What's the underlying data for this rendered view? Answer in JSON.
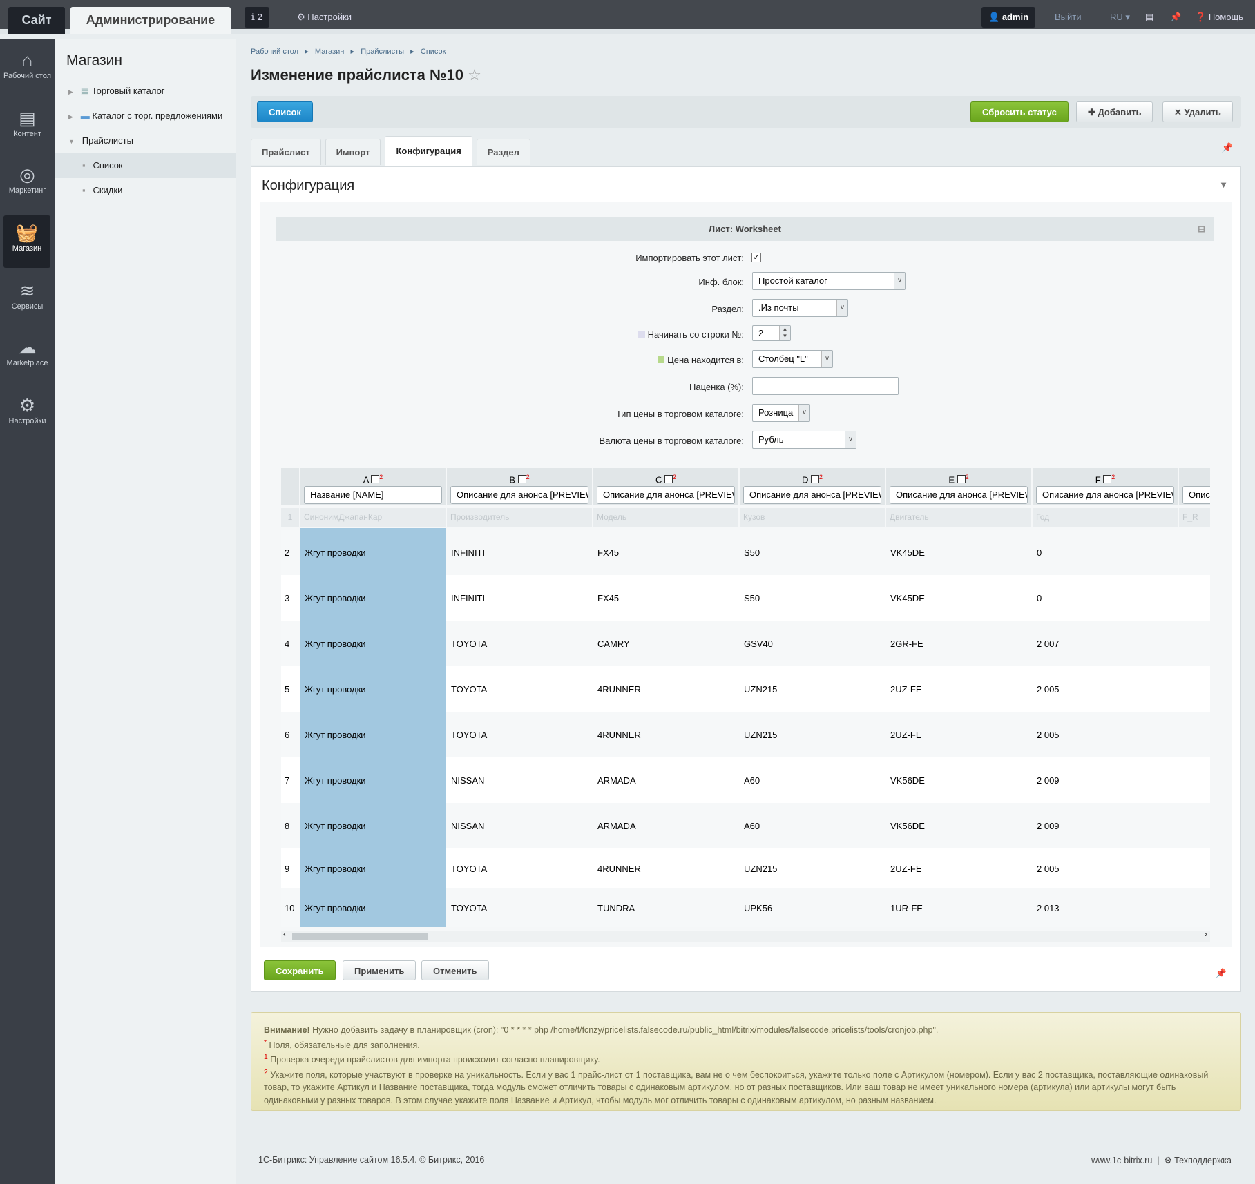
{
  "topbar": {
    "site": "Сайт",
    "admin": "Администрирование",
    "notifications": "2",
    "settings": "Настройки",
    "user": "admin",
    "logout": "Выйти",
    "lang": "RU",
    "help": "Помощь"
  },
  "nav": [
    {
      "label": "Рабочий стол",
      "icon": "home-icon"
    },
    {
      "label": "Контент",
      "icon": "document-icon"
    },
    {
      "label": "Маркетинг",
      "icon": "target-icon"
    },
    {
      "label": "Магазин",
      "icon": "basket-icon"
    },
    {
      "label": "Сервисы",
      "icon": "layers-icon"
    },
    {
      "label": "Marketplace",
      "icon": "cloud-icon"
    },
    {
      "label": "Настройки",
      "icon": "gear-icon"
    }
  ],
  "menu": {
    "title": "Магазин",
    "items": [
      "Торговый каталог",
      "Каталог с торг. предложениями",
      "Прайслисты",
      "Список",
      "Скидки"
    ]
  },
  "breadcrumb": [
    "Рабочий стол",
    "Магазин",
    "Прайслисты",
    "Список"
  ],
  "page_title": "Изменение прайслиста №10",
  "toolbar": {
    "list": "Список",
    "reset": "Сбросить статус",
    "add": "Добавить",
    "delete": "Удалить"
  },
  "tabs": [
    "Прайслист",
    "Импорт",
    "Конфигурация",
    "Раздел"
  ],
  "panel_title": "Конфигурация",
  "sheet": "Лист: Worksheet",
  "form": {
    "import_label": "Импортировать этот лист:",
    "import_checked": true,
    "iblock_label": "Инф. блок:",
    "iblock": "Простой каталог",
    "section_label": "Раздел:",
    "section": ".Из почты",
    "start_label": "Начинать со строки №:",
    "start": "2",
    "price_col_label": "Цена находится в:",
    "price_col": "Столбец \"L\"",
    "markup_label": "Наценка (%):",
    "markup": "",
    "price_type_label": "Тип цены в торговом каталоге:",
    "price_type": "Розница",
    "currency_label": "Валюта цены в торговом каталоге:",
    "currency": "Рубль"
  },
  "columns": [
    {
      "letter": "A",
      "field": "Название [NAME]",
      "sample": "СинонимДжапанКар"
    },
    {
      "letter": "B",
      "field": "Описание для анонса [PREVIEW_TEXT]",
      "sample": "Производитель"
    },
    {
      "letter": "C",
      "field": "Описание для анонса [PREVIEW_TEXT]",
      "sample": "Модель"
    },
    {
      "letter": "D",
      "field": "Описание для анонса [PREVIEW_TEXT]",
      "sample": "Кузов"
    },
    {
      "letter": "E",
      "field": "Описание для анонса [PREVIEW_TEXT]",
      "sample": "Двигатель"
    },
    {
      "letter": "F",
      "field": "Описание для анонса [PREVIEW_TEXT]",
      "sample": "Год"
    },
    {
      "letter": "",
      "field": "Описание",
      "sample": "F_R"
    }
  ],
  "rows": [
    [
      "2",
      "Жгут проводки",
      "INFINITI",
      "FX45",
      "S50",
      "VK45DE",
      "0"
    ],
    [
      "3",
      "Жгут проводки",
      "INFINITI",
      "FX45",
      "S50",
      "VK45DE",
      "0"
    ],
    [
      "4",
      "Жгут проводки",
      "TOYOTA",
      "CAMRY",
      "GSV40",
      "2GR-FE",
      "2 007"
    ],
    [
      "5",
      "Жгут проводки",
      "TOYOTA",
      "4RUNNER",
      "UZN215",
      "2UZ-FE",
      "2 005"
    ],
    [
      "6",
      "Жгут проводки",
      "TOYOTA",
      "4RUNNER",
      "UZN215",
      "2UZ-FE",
      "2 005"
    ],
    [
      "7",
      "Жгут проводки",
      "NISSAN",
      "ARMADA",
      "A60",
      "VK56DE",
      "2 009"
    ],
    [
      "8",
      "Жгут проводки",
      "NISSAN",
      "ARMADA",
      "A60",
      "VK56DE",
      "2 009"
    ],
    [
      "9",
      "Жгут проводки",
      "TOYOTA",
      "4RUNNER",
      "UZN215",
      "2UZ-FE",
      "2 005"
    ],
    [
      "10",
      "Жгут проводки",
      "TOYOTA",
      "TUNDRA",
      "UPK56",
      "1UR-FE",
      "2 013"
    ]
  ],
  "buttons": {
    "save": "Сохранить",
    "apply": "Применить",
    "cancel": "Отменить"
  },
  "note": {
    "warn_bold": "Внимание!",
    "warn": " Нужно добавить задачу в планировщик (cron): \"0 * * * * php /home/f/fcnzy/pricelists.falsecode.ru/public_html/bitrix/modules/falsecode.pricelists/tools/cronjob.php\".",
    "req": "Поля, обязательные для заполнения.",
    "n1": "Проверка очереди прайслистов для импорта происходит согласно планировщику.",
    "n2": "Укажите поля, которые участвуют в проверке на уникальность. Если у вас 1 прайс-лист от 1 поставщика, вам не о чем беспокоиться, укажите только поле с Артикулом (номером). Если у вас 2 поставщика, поставляющие одинаковый товар, то укажите Артикул и Название поставщика, тогда модуль сможет отличить товары с одинаковым артикулом, но от разных поставщиков. Или ваш товар не имеет уникального номера (артикула) или артикулы могут быть одинаковыми у разных товаров. В этом случае укажите поля Название и Артикул, чтобы модуль мог отличить товары с одинаковым артикулом, но разным названием."
  },
  "footer": {
    "copyright": "1С-Битрикс: Управление сайтом 16.5.4. © Битрикс, 2016",
    "site": "www.1c-bitrix.ru",
    "support": "Техподдержка"
  },
  "colors": {
    "accent_green": "#6aa51d",
    "highlight": "#a2c8e0",
    "note_bg": "#ece8c2"
  }
}
